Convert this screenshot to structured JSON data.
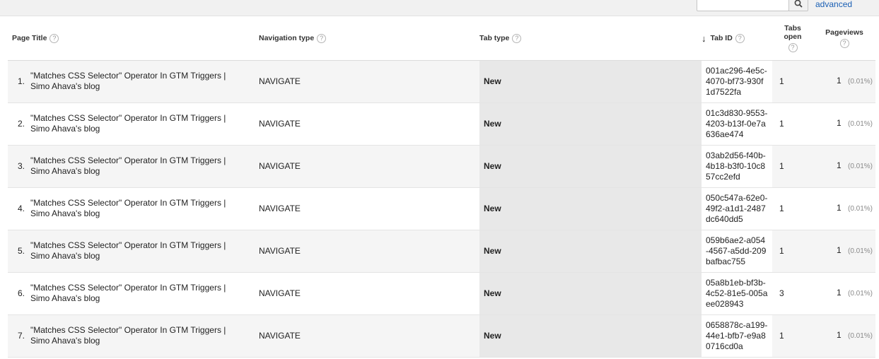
{
  "toolbar": {
    "search": {
      "value": "",
      "placeholder": ""
    },
    "advanced_label": "advanced",
    "search_icon": "search-icon"
  },
  "table": {
    "headers": {
      "page_title": "Page Title",
      "navigation_type": "Navigation type",
      "tab_type": "Tab type",
      "tab_id": "Tab ID",
      "tabs_open": "Tabs open",
      "pageviews": "Pageviews",
      "help_glyph": "?",
      "sort_glyph": "↓"
    },
    "rows": [
      {
        "index": "1.",
        "page_title": "\"Matches CSS Selector\" Operator In GTM Triggers | Simo Ahava's blog",
        "navigation_type": "NAVIGATE",
        "tab_type": "New",
        "tab_id": "001ac296-4e5c-4070-bf73-930f1d7522fa",
        "tabs_open": "1",
        "pageviews": "1",
        "pageviews_pct": "(0.01%)"
      },
      {
        "index": "2.",
        "page_title": "\"Matches CSS Selector\" Operator In GTM Triggers | Simo Ahava's blog",
        "navigation_type": "NAVIGATE",
        "tab_type": "New",
        "tab_id": "01c3d830-9553-4203-b13f-0e7a636ae474",
        "tabs_open": "1",
        "pageviews": "1",
        "pageviews_pct": "(0.01%)"
      },
      {
        "index": "3.",
        "page_title": "\"Matches CSS Selector\" Operator In GTM Triggers | Simo Ahava's blog",
        "navigation_type": "NAVIGATE",
        "tab_type": "New",
        "tab_id": "03ab2d56-f40b-4b18-b3f0-10c857cc2efd",
        "tabs_open": "1",
        "pageviews": "1",
        "pageviews_pct": "(0.01%)"
      },
      {
        "index": "4.",
        "page_title": "\"Matches CSS Selector\" Operator In GTM Triggers | Simo Ahava's blog",
        "navigation_type": "NAVIGATE",
        "tab_type": "New",
        "tab_id": "050c547a-62e0-49f2-a1d1-2487dc640dd5",
        "tabs_open": "1",
        "pageviews": "1",
        "pageviews_pct": "(0.01%)"
      },
      {
        "index": "5.",
        "page_title": "\"Matches CSS Selector\" Operator In GTM Triggers | Simo Ahava's blog",
        "navigation_type": "NAVIGATE",
        "tab_type": "New",
        "tab_id": "059b6ae2-a054-4567-a5dd-209bafbac755",
        "tabs_open": "1",
        "pageviews": "1",
        "pageviews_pct": "(0.01%)"
      },
      {
        "index": "6.",
        "page_title": "\"Matches CSS Selector\" Operator In GTM Triggers | Simo Ahava's blog",
        "navigation_type": "NAVIGATE",
        "tab_type": "New",
        "tab_id": "05a8b1eb-bf3b-4c52-81e5-005aee028943",
        "tabs_open": "3",
        "pageviews": "1",
        "pageviews_pct": "(0.01%)"
      },
      {
        "index": "7.",
        "page_title": "\"Matches CSS Selector\" Operator In GTM Triggers | Simo Ahava's blog",
        "navigation_type": "NAVIGATE",
        "tab_type": "New",
        "tab_id": "0658878c-a199-44e1-bfb7-e9a80716cd0a",
        "tabs_open": "1",
        "pageviews": "1",
        "pageviews_pct": "(0.01%)"
      }
    ]
  }
}
